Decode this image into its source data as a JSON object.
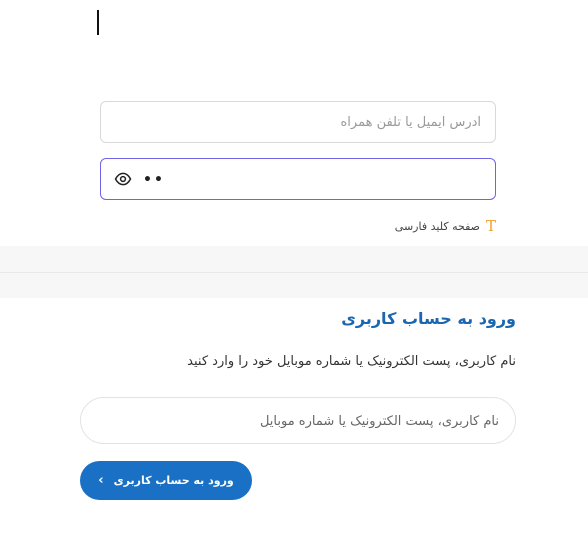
{
  "legacy_form": {
    "email_placeholder": "آدرس ایمیل یا تلفن همراه",
    "password_value": "••",
    "keyboard_label": "صفحه کلید فارسی",
    "keyboard_icon": "T"
  },
  "login": {
    "title": "ورود به حساب کاربری",
    "description": "نام کاربری، پست الکترونیک یا شماره موبایل خود را وارد کنید",
    "username_placeholder": "نام کاربری، پست الکترونیک یا شماره موبایل",
    "submit_label": "ورود به حساب کاربری",
    "submit_chevron": "‹"
  },
  "colors": {
    "accent": "#1a70c4",
    "title": "#1a66b0",
    "focus_border": "#6f63e6",
    "keyboard_icon": "#f0a030"
  }
}
